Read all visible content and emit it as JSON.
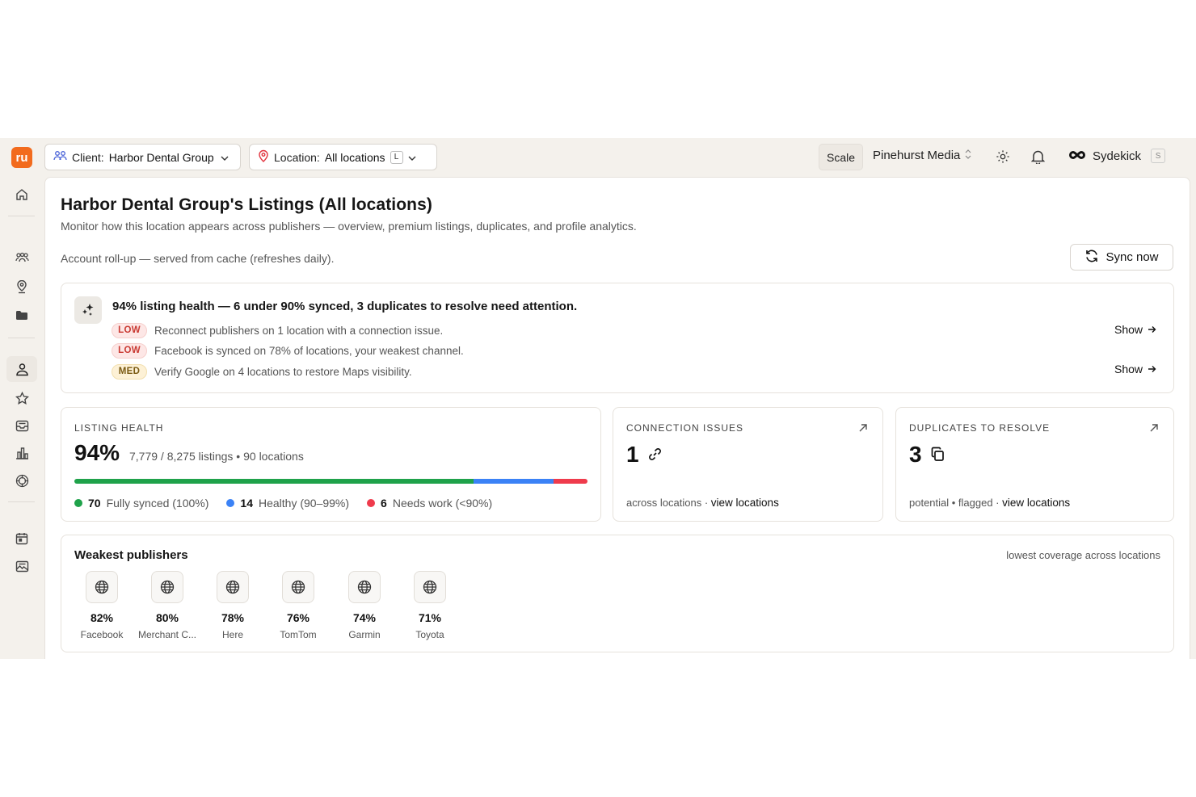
{
  "app": {
    "logo_text": "ru",
    "brand_color": "#f26b1d"
  },
  "topbar": {
    "client_label": "Client:",
    "client_value": "Harbor Dental Group",
    "location_label": "Location:",
    "location_value": "All locations",
    "location_shortcut": "L",
    "plan": "Scale",
    "org_name": "Pinehurst Media",
    "assistant_name": "Sydekick",
    "assistant_shortcut": "S"
  },
  "sidebar": {
    "items": [
      {
        "icon": "home-icon"
      },
      {
        "icon": "users-icon"
      },
      {
        "icon": "location-pin-icon"
      },
      {
        "icon": "folder-icon"
      },
      {
        "icon": "listings-icon",
        "active": true
      },
      {
        "icon": "star-icon"
      },
      {
        "icon": "inbox-icon"
      },
      {
        "icon": "bar-chart-icon"
      },
      {
        "icon": "ai-swirl-icon"
      },
      {
        "icon": "calendar-icon"
      },
      {
        "icon": "image-icon"
      }
    ]
  },
  "page": {
    "title": "Harbor Dental Group's Listings (All locations)",
    "subtitle": "Monitor how this location appears across publishers — overview, premium listings, duplicates, and profile analytics.",
    "rollup_note": "Account roll-up — served from cache (refreshes daily).",
    "sync_button": "Sync now"
  },
  "alerts": {
    "headline": "94% listing health — 6 under 90% synced, 3 duplicates to resolve need attention.",
    "items": [
      {
        "severity": "LOW",
        "text": "Reconnect publishers on 1 location with a connection issue.",
        "action": "Show"
      },
      {
        "severity": "LOW",
        "text": "Facebook is synced on 78% of locations, your weakest channel.",
        "action": ""
      },
      {
        "severity": "MED",
        "text": "Verify Google on 4 locations to restore Maps visibility.",
        "action": "Show"
      }
    ]
  },
  "listing_health": {
    "label": "LISTING HEALTH",
    "percent": "94%",
    "detail": "7,779 / 8,275 listings • 90 locations",
    "segments": [
      {
        "count": "70",
        "label": "Fully synced (100%)",
        "color": "#1fa24a",
        "value": 70
      },
      {
        "count": "14",
        "label": "Healthy (90–99%)",
        "color": "#3b82f6",
        "value": 14
      },
      {
        "count": "6",
        "label": "Needs work (<90%)",
        "color": "#ef3b4c",
        "value": 6
      }
    ]
  },
  "connection_issues": {
    "label": "CONNECTION ISSUES",
    "value": "1",
    "foot_text": "across locations ·",
    "foot_link": "view locations"
  },
  "duplicates": {
    "label": "DUPLICATES TO RESOLVE",
    "value": "3",
    "foot_text": "potential • flagged ·",
    "foot_link": "view locations"
  },
  "weakest_publishers": {
    "title": "Weakest publishers",
    "note": "lowest coverage across locations",
    "items": [
      {
        "percent": "82%",
        "name": "Facebook"
      },
      {
        "percent": "80%",
        "name": "Merchant C..."
      },
      {
        "percent": "78%",
        "name": "Here"
      },
      {
        "percent": "76%",
        "name": "TomTom"
      },
      {
        "percent": "74%",
        "name": "Garmin"
      },
      {
        "percent": "71%",
        "name": "Toyota"
      }
    ]
  }
}
